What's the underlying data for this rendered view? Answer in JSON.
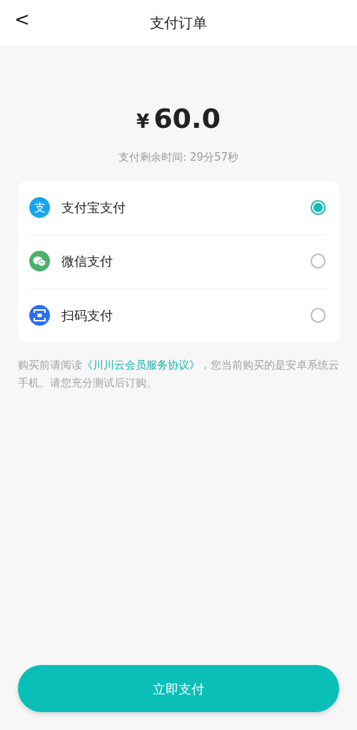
{
  "header": {
    "back": "<",
    "title": "支付订单"
  },
  "amount": {
    "currency": "¥",
    "value": "60.0"
  },
  "timer": "支付剩余时间: 29分57秒",
  "payment_methods": [
    {
      "kind": "alipay",
      "icon_glyph": "支",
      "label": "支付宝支付",
      "selected": true
    },
    {
      "kind": "wechat",
      "label": "微信支付",
      "selected": false
    },
    {
      "kind": "scan",
      "label": "扫码支付",
      "selected": false
    }
  ],
  "notice": {
    "before": "购买前请阅读",
    "link": "《川川云会员服务协议》",
    "after": "，您当前购买的是安卓系统云手机。请您充分测试后订购。"
  },
  "pay_button": "立即支付"
}
